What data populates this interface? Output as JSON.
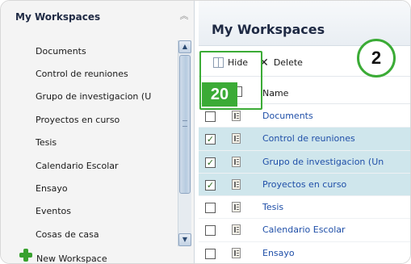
{
  "left_nav": {
    "title": "My Workspaces",
    "items": [
      {
        "label": "Documents"
      },
      {
        "label": "Control de reuniones"
      },
      {
        "label": "Grupo de investigacion (U"
      },
      {
        "label": "Proyectos en curso"
      },
      {
        "label": "Tesis"
      },
      {
        "label": "Calendario Escolar"
      },
      {
        "label": "Ensayo"
      },
      {
        "label": "Eventos"
      },
      {
        "label": "Cosas de casa"
      }
    ],
    "new_workspace_label": "New Workspace"
  },
  "main": {
    "title": "My Workspaces",
    "toolbar": {
      "hide_label": "Hide",
      "delete_label": "Delete"
    },
    "column_header": "Name",
    "rows": [
      {
        "name": "Documents",
        "checked": false
      },
      {
        "name": "Control de reuniones",
        "checked": true
      },
      {
        "name": "Grupo de investigacion (Un",
        "checked": true
      },
      {
        "name": "Proyectos en curso",
        "checked": true
      },
      {
        "name": "Tesis",
        "checked": false
      },
      {
        "name": "Calendario Escolar",
        "checked": false
      },
      {
        "name": "Ensayo",
        "checked": false
      }
    ]
  },
  "callouts": {
    "badge_20": "20",
    "circle_2": "2"
  },
  "colors": {
    "callout_green": "#3bab36",
    "selected_row": "#cfe6ec",
    "link_blue": "#1f4fa8"
  },
  "icons": {
    "collapse": "double-chevron-up-icon",
    "hide": "columns-icon",
    "delete": "x-icon",
    "new_workspace": "plus-icon",
    "row_item": "document-icon"
  }
}
